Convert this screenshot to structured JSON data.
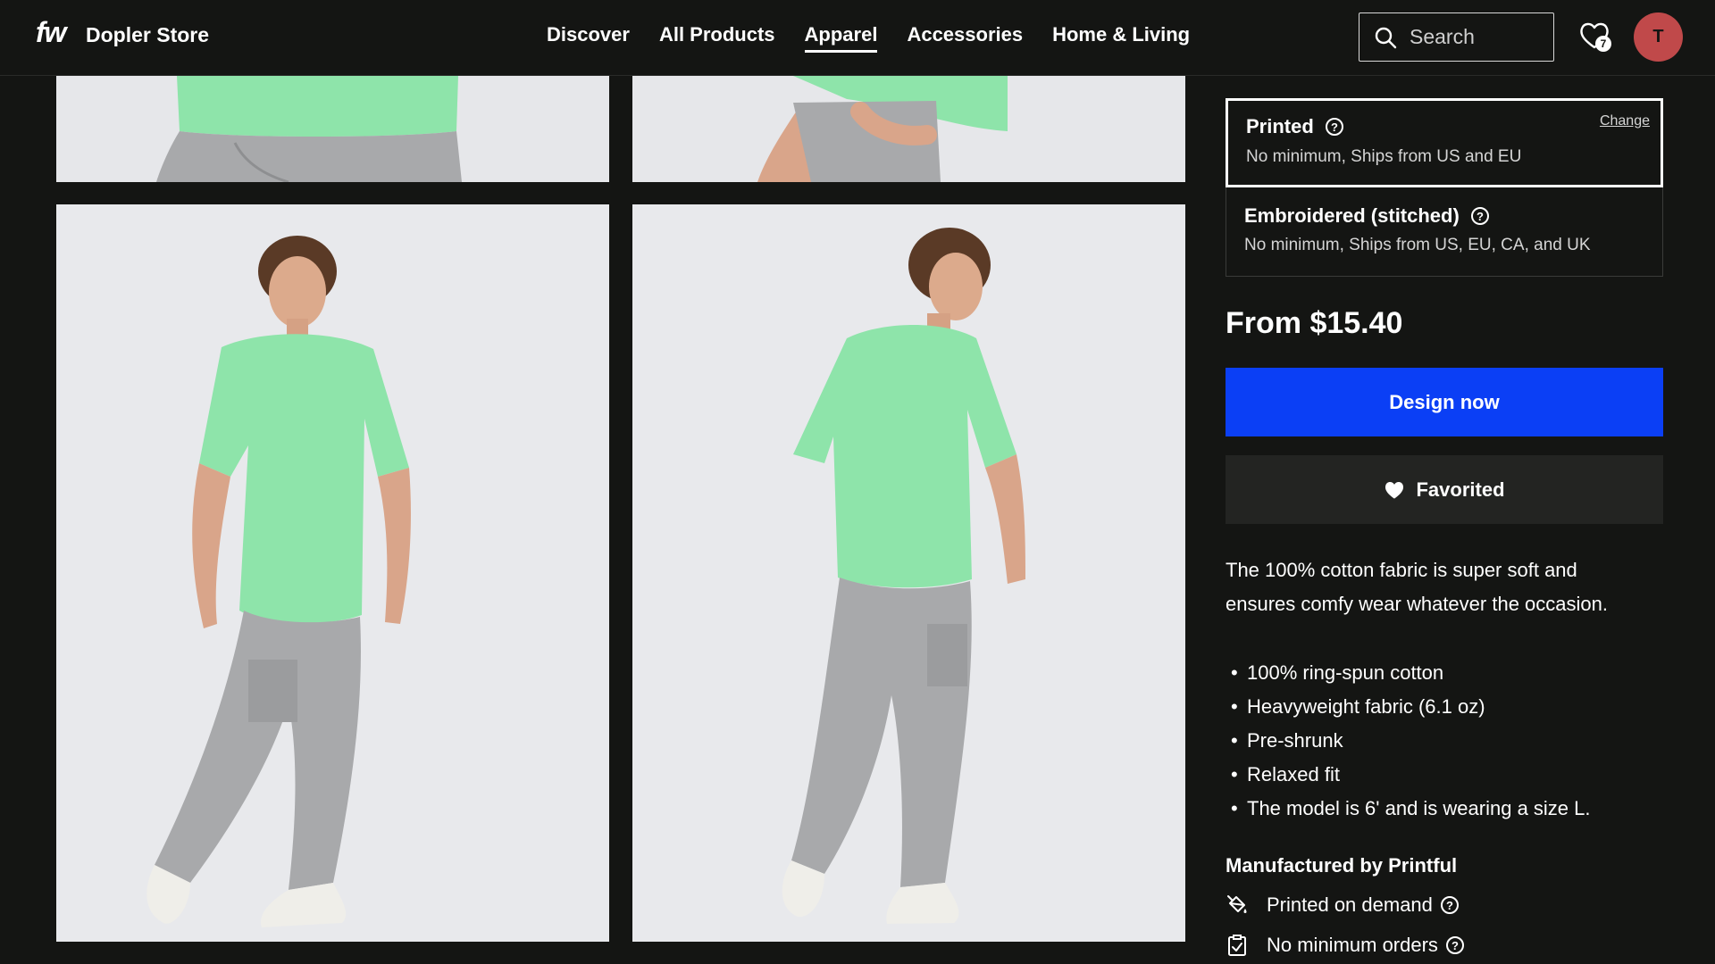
{
  "header": {
    "logo": "fw",
    "store_name": "Dopler Store",
    "nav": [
      "Discover",
      "All Products",
      "Apparel",
      "Accessories",
      "Home & Living"
    ],
    "active_nav": "Apparel",
    "search_placeholder": "Search",
    "favorites_count": "7",
    "avatar_initial": "T"
  },
  "product": {
    "options": [
      {
        "title": "Printed",
        "subtitle": "No minimum, Ships from US and EU",
        "selected": true,
        "action": "Change"
      },
      {
        "title": "Embroidered (stitched)",
        "subtitle": "No minimum, Ships from US, EU, CA, and UK",
        "selected": false
      }
    ],
    "price": "From $15.40",
    "design_button": "Design now",
    "favorited_button": "Favorited",
    "description": "The 100% cotton fabric is super soft and ensures comfy wear whatever the occasion.",
    "bullets": [
      "100% ring-spun cotton",
      "Heavyweight fabric (6.1 oz)",
      "Pre-shrunk",
      "Relaxed fit",
      "The model is 6' and is wearing a size L."
    ],
    "manufacturer_title": "Manufactured by Printful",
    "features": [
      "Printed on demand",
      "No minimum orders"
    ]
  },
  "colors": {
    "background": "#141513",
    "accent_blue": "#0b3ff5",
    "avatar": "#c0494a",
    "shirt_green": "#8ee4aa",
    "pants_gray": "#a9a9a9"
  }
}
